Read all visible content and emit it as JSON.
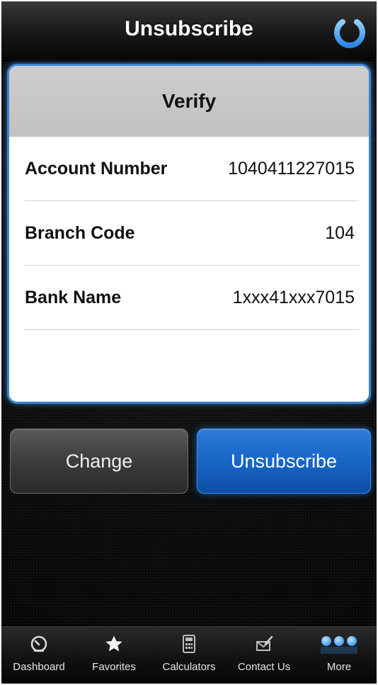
{
  "header": {
    "title": "Unsubscribe",
    "power_icon": "power-icon"
  },
  "card": {
    "title": "Verify",
    "rows": [
      {
        "label": "Account Number",
        "value": "1040411227015"
      },
      {
        "label": "Branch Code",
        "value": "104"
      },
      {
        "label": "Bank Name",
        "value": "1xxx41xxx7015"
      }
    ]
  },
  "actions": {
    "change_label": "Change",
    "unsubscribe_label": "Unsubscribe"
  },
  "tabbar": {
    "items": [
      {
        "label": "Dashboard",
        "icon": "speedometer-icon"
      },
      {
        "label": "Favorites",
        "icon": "star-icon"
      },
      {
        "label": "Calculators",
        "icon": "calculator-icon"
      },
      {
        "label": "Contact Us",
        "icon": "envelope-pen-icon"
      },
      {
        "label": "More",
        "icon": "more-dots-icon"
      }
    ]
  },
  "colors": {
    "accent_blue": "#1866c6",
    "card_border": "#3a86d1",
    "power_icon": "#4aa3f0"
  }
}
